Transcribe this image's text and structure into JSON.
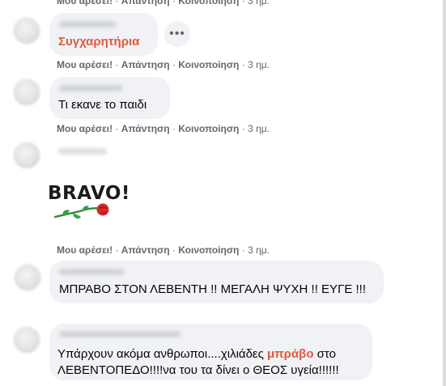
{
  "actions": {
    "like": "Μου αρέσει!",
    "reply": "Απάντηση",
    "share": "Κοινοποίηση",
    "separator": "·",
    "time": "3 ημ."
  },
  "comments": [
    {
      "text": "Συγχαρητήρια"
    },
    {
      "text": "Τι εκανε το παιδι"
    },
    {
      "sticker_text": "BRAVO!"
    },
    {
      "text": "ΜΠΡΑΒΟ ΣΤΟΝ ΛΕΒΕΝΤΗ !! ΜΕΓΑΛΗ ΨΥΧΗ !! ΕΥΓΕ !!!"
    },
    {
      "line1_before": "Υπάρχουν ακόμα ανθρωποι....χιλιάδες ",
      "line1_highlight": "μπράβο",
      "line1_after": " στο",
      "line2": "ΛΕΒΕΝΤΟΠΕΔΟ!!!!να του τα δίνει ο ΘΕΟΣ υγεία!!!!!!"
    }
  ],
  "colors": {
    "highlight": "#e4573d",
    "bubble": "#f0f2f5",
    "meta": "#65676b"
  },
  "icons": {
    "more": "more-horizontal-icon",
    "sticker": "rose-icon"
  }
}
